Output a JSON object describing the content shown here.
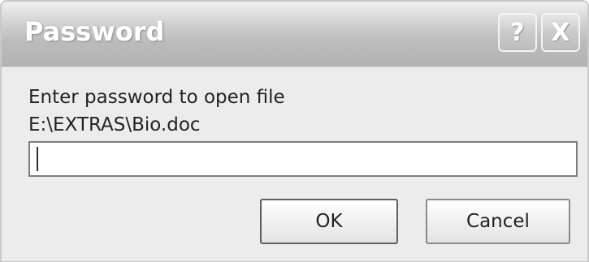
{
  "window": {
    "title": "Password",
    "help_glyph": "?",
    "close_glyph": "X"
  },
  "dialog": {
    "prompt_line1": "Enter password to open file",
    "prompt_line2": "E:\\EXTRAS\\Bio.doc",
    "password_value": "",
    "ok_label": "OK",
    "cancel_label": "Cancel"
  },
  "icons": {
    "help": "help-icon",
    "close": "close-icon"
  }
}
